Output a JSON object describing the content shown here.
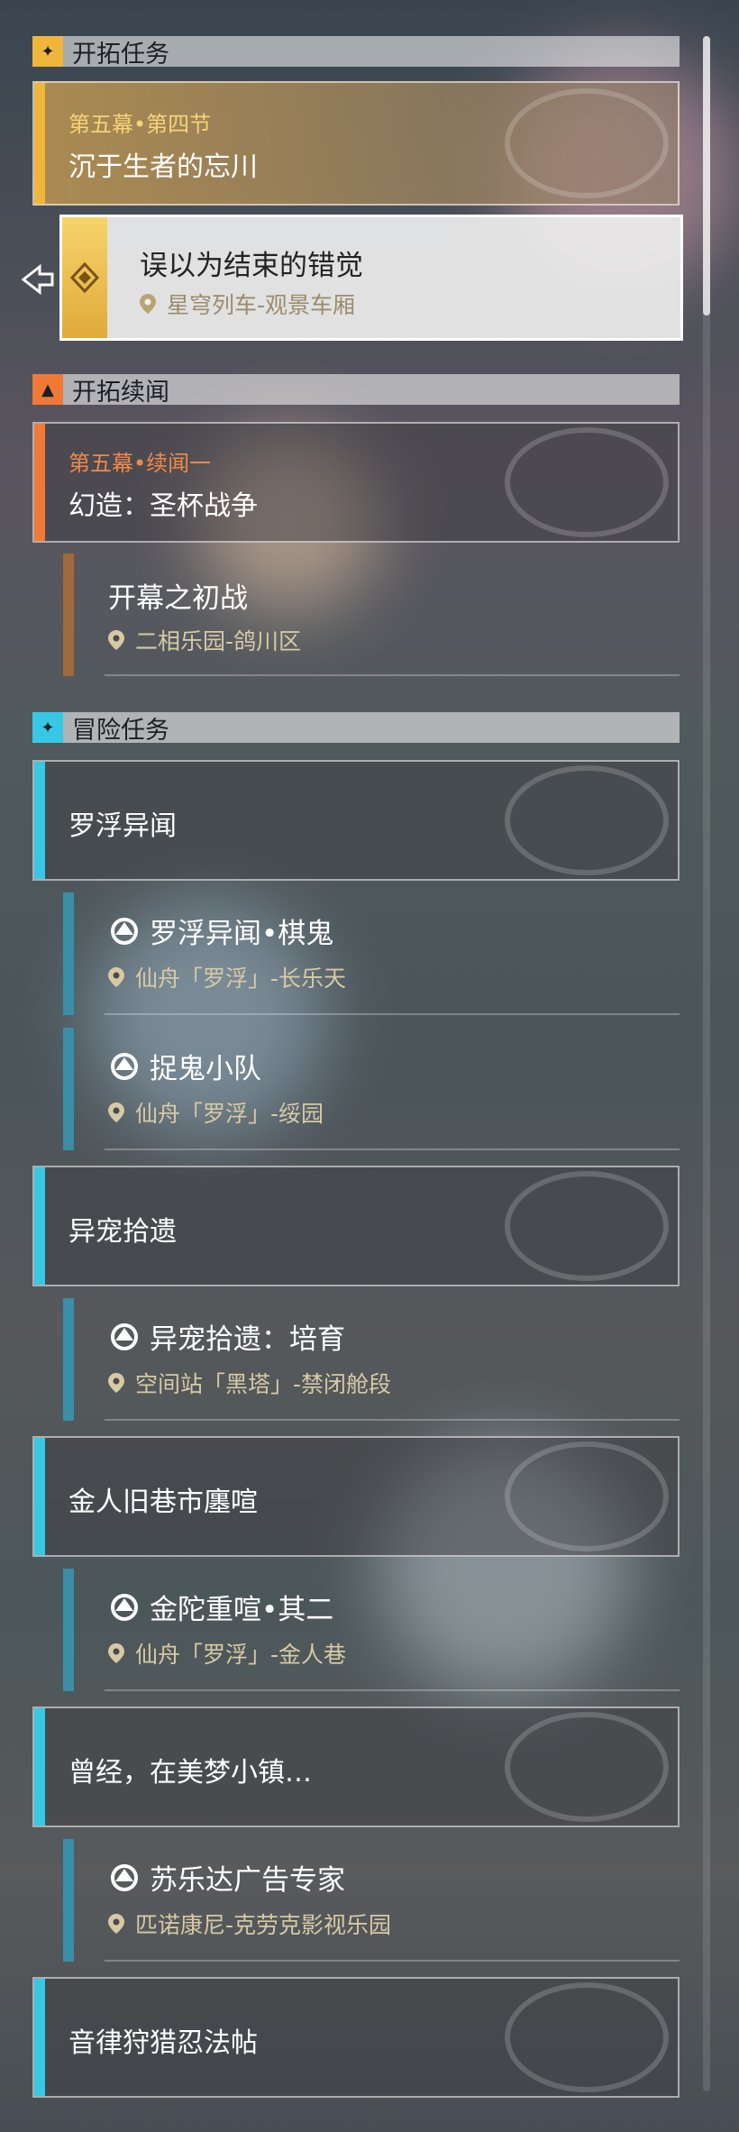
{
  "sections": {
    "trailblaze": {
      "title": "开拓任务",
      "color": "#f0b63c"
    },
    "continuance": {
      "title": "开拓续闻",
      "color": "#f07a35"
    },
    "adventure": {
      "title": "冒险任务",
      "color": "#38c8e6"
    }
  },
  "trailblaze_card": {
    "subtitle": "第五幕•第四节",
    "title": "沉于生者的忘川"
  },
  "trailblaze_active": {
    "title": "误以为结束的错觉",
    "location": "星穹列车-观景车厢"
  },
  "continuance_card": {
    "subtitle": "第五幕•续闻一",
    "title": "幻造：圣杯战争"
  },
  "continuance_sub": {
    "title": "开幕之初战",
    "location": "二相乐园-鸽川区"
  },
  "adventure_groups": [
    {
      "title": "罗浮异闻",
      "quests": [
        {
          "title": "罗浮异闻•棋鬼",
          "location": "仙舟「罗浮」-长乐天"
        },
        {
          "title": "捉鬼小队",
          "location": "仙舟「罗浮」-绥园"
        }
      ]
    },
    {
      "title": "异宠拾遗",
      "quests": [
        {
          "title": "异宠拾遗：培育",
          "location": "空间站「黑塔」-禁闭舱段"
        }
      ]
    },
    {
      "title": "金人旧巷市廛喧",
      "quests": [
        {
          "title": "金陀重喧•其二",
          "location": "仙舟「罗浮」-金人巷"
        }
      ]
    },
    {
      "title": "曾经，在美梦小镇…",
      "quests": [
        {
          "title": "苏乐达广告专家",
          "location": "匹诺康尼-克劳克影视乐园"
        }
      ]
    },
    {
      "title": "音律狩猎忍法帖",
      "quests": []
    }
  ]
}
